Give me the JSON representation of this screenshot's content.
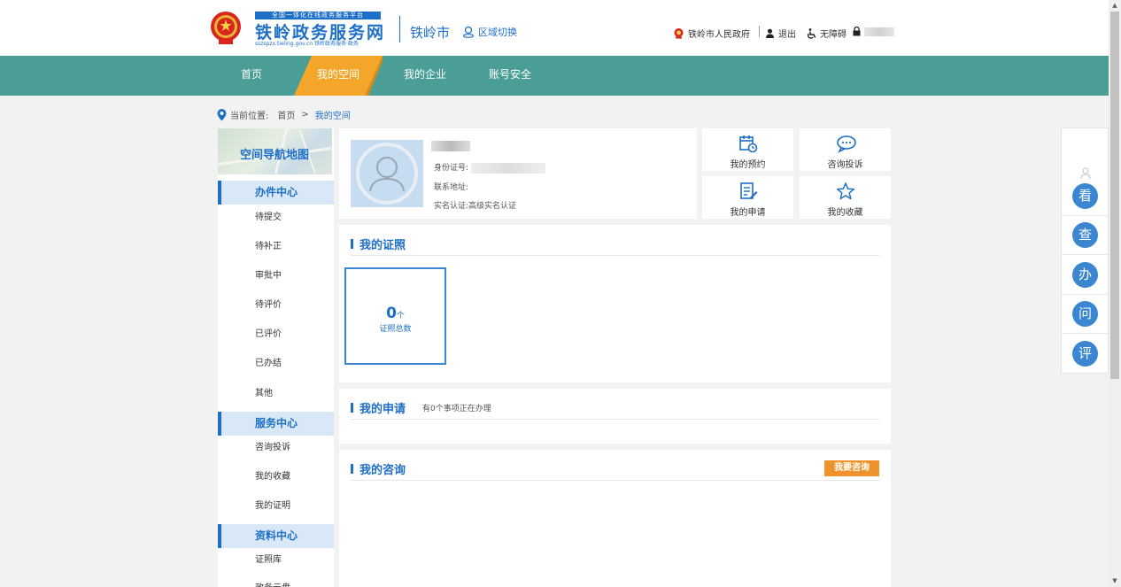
{
  "header": {
    "platform_tag": "全国一体化在线政务服务平台",
    "site_title": "铁岭政务服务网",
    "site_subtitle": "sszspzx.tieling.gov.cn  铁岭政务服务·政务",
    "city": "铁岭市",
    "region_switch": "区域切换",
    "gov_link": "铁岭市人民政府",
    "logout": "退出",
    "accessibility": "无障碍"
  },
  "nav": {
    "items": [
      "首页",
      "我的空间",
      "我的企业",
      "账号安全"
    ],
    "active": "我的空间"
  },
  "breadcrumb": {
    "prefix": "当前位置:",
    "home": "首页",
    "separator": ">",
    "current": "我的空间"
  },
  "sidebar": {
    "map_banner": "空间导航地图",
    "sections": [
      {
        "title": "办件中心",
        "items": [
          "待提交",
          "待补正",
          "审批中",
          "待评价",
          "已评价",
          "已办结",
          "其他"
        ]
      },
      {
        "title": "服务中心",
        "items": [
          "咨询投诉",
          "我的收藏",
          "我的证明"
        ]
      },
      {
        "title": "资料中心",
        "items": [
          "证照库",
          "政务云盘"
        ]
      }
    ]
  },
  "profile": {
    "id_label": "身份证号:",
    "address_label": "联系地址:",
    "auth_label": "实名认证:",
    "auth_value": "高级实名认证"
  },
  "quick_links": {
    "appointment": "我的预约",
    "consult": "咨询投诉",
    "application": "我的申请",
    "favorites": "我的收藏"
  },
  "certificates": {
    "title": "我的证照",
    "count": "0",
    "unit": "个",
    "label": "证照总数"
  },
  "applications": {
    "title": "我的申请",
    "note": "有0个事项正在办理"
  },
  "consultations": {
    "title": "我的咨询",
    "button": "我要咨询"
  },
  "float_bar": {
    "buttons": [
      "看",
      "查",
      "办",
      "问",
      "评"
    ]
  },
  "colors": {
    "nav_bg": "#4a9e96",
    "primary_blue": "#1d6fc7",
    "active_tab": "#f4a62a",
    "consult_button": "#f0922c"
  }
}
